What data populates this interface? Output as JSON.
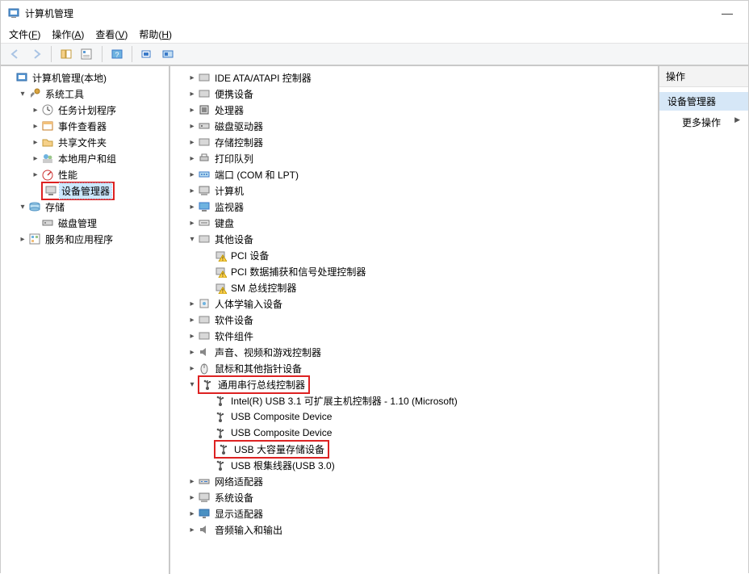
{
  "window": {
    "title": "计算机管理",
    "minimize": "—"
  },
  "menu": {
    "file": "文件(<u>F</u>)",
    "action": "操作(<u>A</u>)",
    "view": "查看(<u>V</u>)",
    "help": "帮助(<u>H</u>)"
  },
  "left": {
    "root": "计算机管理(本地)",
    "sys_tools": "系统工具",
    "task_scheduler": "任务计划程序",
    "event_viewer": "事件查看器",
    "shared_folders": "共享文件夹",
    "local_users": "本地用户和组",
    "performance": "性能",
    "device_manager": "设备管理器",
    "storage": "存储",
    "disk_mgmt": "磁盘管理",
    "services_apps": "服务和应用程序"
  },
  "center": {
    "ide": "IDE ATA/ATAPI 控制器",
    "portable": "便携设备",
    "processors": "处理器",
    "disk_drives": "磁盘驱动器",
    "storage_ctrl": "存储控制器",
    "print_queues": "打印队列",
    "ports": "端口 (COM 和 LPT)",
    "computer": "计算机",
    "monitors": "监视器",
    "keyboards": "键盘",
    "other_devices": "其他设备",
    "pci_device": "PCI 设备",
    "pci_data_acq": "PCI 数据捕获和信号处理控制器",
    "sm_bus": "SM 总线控制器",
    "hid": "人体学输入设备",
    "software_devices": "软件设备",
    "software_components": "软件组件",
    "sound": "声音、视频和游戏控制器",
    "mice": "鼠标和其他指针设备",
    "usb_ctrl": "通用串行总线控制器",
    "usb_intel": "Intel(R) USB 3.1 可扩展主机控制器 - 1.10 (Microsoft)",
    "usb_comp1": "USB Composite Device",
    "usb_comp2": "USB Composite Device",
    "usb_mass": "USB 大容量存储设备",
    "usb_root": "USB 根集线器(USB 3.0)",
    "network": "网络适配器",
    "system_devices": "系统设备",
    "display": "显示适配器",
    "audio_io": "音频输入和输出"
  },
  "right": {
    "header": "操作",
    "item_sel": "设备管理器",
    "item_more": "更多操作"
  }
}
